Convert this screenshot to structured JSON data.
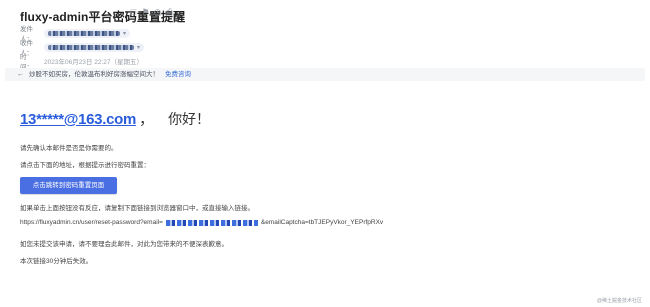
{
  "email": {
    "subject": "fluxy-admin平台密码重置提醒",
    "sender_label": "发件人：",
    "recipient_label": "收件人：",
    "time_label": "时　间：",
    "time_value": "2023年06月23日 22:27（星期五）"
  },
  "notice": {
    "message": "炒股不如买房，伦敦温布利好房涨幅空间大！",
    "link": "免费咨询"
  },
  "body": {
    "greeting_address": "13*****@163.com",
    "greeting_comma": "，",
    "greeting_hello": "你好！",
    "line_confirm": "请先确认本邮件是否是你需要的。",
    "line_click": "请点击下面的地址，根据提示进行密码重置：",
    "reset_button": "点击跳转到密码重置页面",
    "line_copy": "如果单击上面按钮没有反应，请复制下面链接到浏览器窗口中，或直接输入链接。",
    "link_prefix": "https://fluxyadmin.cn/user/reset-password?email=",
    "link_suffix": "&emailCaptcha=tbTJEPyVkor_YEPrfpRXv",
    "line_ignore": "如您未提交该申请，请不要理会此邮件，对此为您带来的不便深表歉意。",
    "line_expire": "本次链接30分钟后失效。"
  },
  "watermark": "@稀土掘金技术社区"
}
